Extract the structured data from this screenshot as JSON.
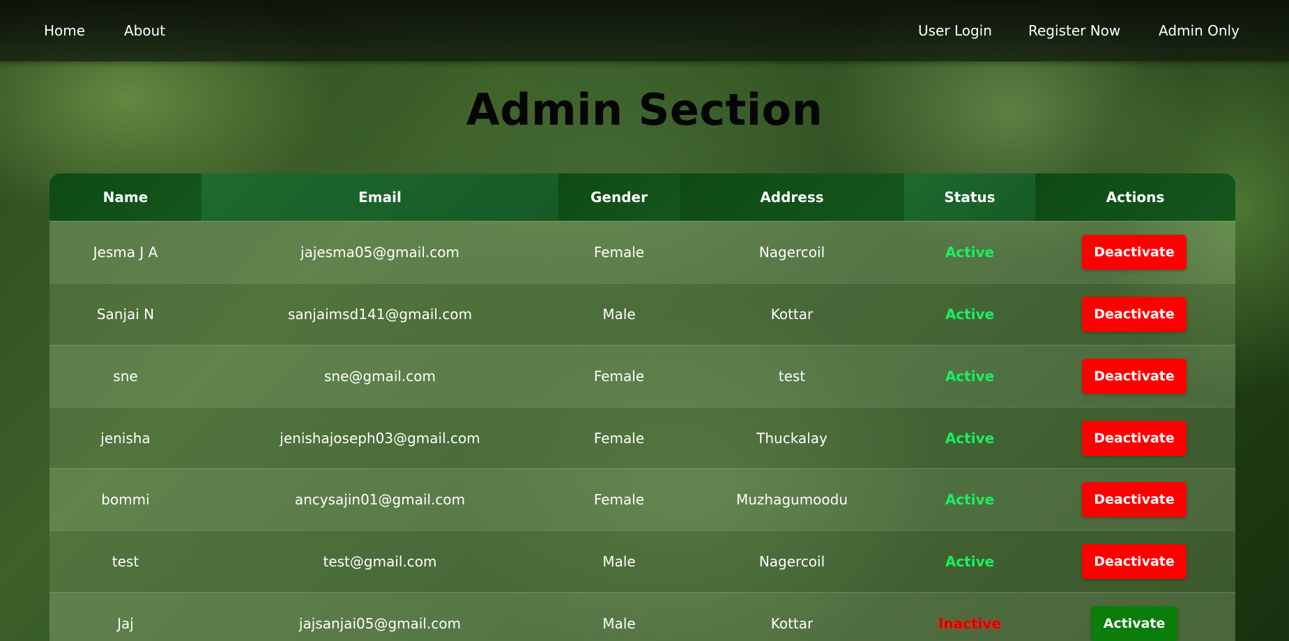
{
  "nav": {
    "left": [
      "Home",
      "About"
    ],
    "right": [
      "User Login",
      "Register Now",
      "Admin Only"
    ]
  },
  "title": "Admin Section",
  "table": {
    "headers": [
      "Name",
      "Email",
      "Gender",
      "Address",
      "Status",
      "Actions"
    ],
    "rows": [
      {
        "name": "Jesma J A",
        "email": "jajesma05@gmail.com",
        "gender": "Female",
        "address": "Nagercoil",
        "status": "Active",
        "action": "Deactivate"
      },
      {
        "name": "Sanjai N",
        "email": "sanjaimsd141@gmail.com",
        "gender": "Male",
        "address": "Kottar",
        "status": "Active",
        "action": "Deactivate"
      },
      {
        "name": "sne",
        "email": "sne@gmail.com",
        "gender": "Female",
        "address": "test",
        "status": "Active",
        "action": "Deactivate"
      },
      {
        "name": "jenisha",
        "email": "jenishajoseph03@gmail.com",
        "gender": "Female",
        "address": "Thuckalay",
        "status": "Active",
        "action": "Deactivate"
      },
      {
        "name": "bommi",
        "email": "ancysajin01@gmail.com",
        "gender": "Female",
        "address": "Muzhagumoodu",
        "status": "Active",
        "action": "Deactivate"
      },
      {
        "name": "test",
        "email": "test@gmail.com",
        "gender": "Male",
        "address": "Nagercoil",
        "status": "Active",
        "action": "Deactivate"
      },
      {
        "name": "Jaj",
        "email": "jajsanjai05@gmail.com",
        "gender": "Male",
        "address": "Kottar",
        "status": "Inactive",
        "action": "Activate"
      }
    ]
  },
  "colors": {
    "active_status": "#19f060",
    "inactive_status": "#d90000",
    "deactivate_button": "#ff0000",
    "activate_button": "#0a7d0a",
    "header_green": "#14571d"
  }
}
